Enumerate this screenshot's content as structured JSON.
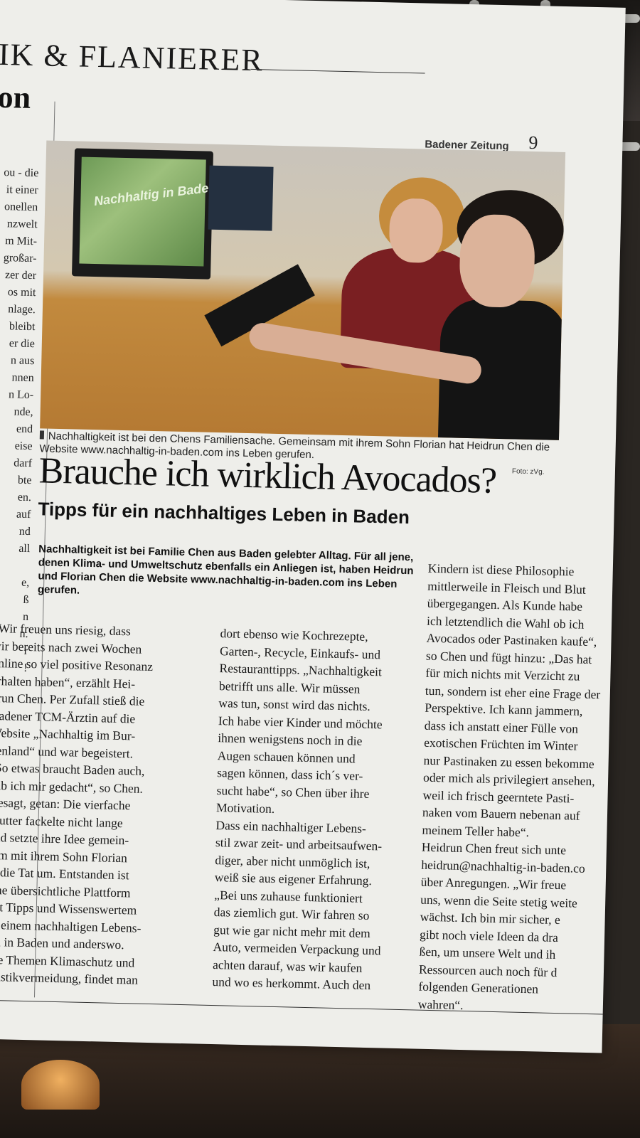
{
  "page": {
    "section_title": "IK & FLANIERER",
    "left_fragment": "on",
    "newspaper_name": "Badener Zeitung",
    "page_number": "9"
  },
  "left_column_fragment": "ou - die\nit einer\nonellen\nnzwelt\nm Mit-\ngroßar-\nzer der\nos mit\nnlage.\nbleibt\ner die\nn aus\nnnen\nn Lo-\nnde,\nend\neise\ndarf\nbte\nen.\nauf\nnd\nall\n\ne,\nß\nn\nn.\nr\n!",
  "photo": {
    "screen_text": "Nachhaltig in Baden",
    "caption": "Nachhaltigkeit ist bei den Chens Familiensache. Gemeinsam mit ihrem Sohn Florian hat Heidrun Chen die Website www.nachhaltig-in-baden.com ins Leben gerufen.",
    "credit": "Foto: zVg."
  },
  "article": {
    "headline": "Brauche ich wirklich Avocados?",
    "subheadline": "Tipps für ein nachhaltiges Leben in Baden",
    "lead": "Nachhaltigkeit ist bei Familie Chen aus Baden gelebter Alltag. Für all jene, denen Klima- und Umweltschutz ebenfalls ein Anliegen ist, haben Heidrun und Florian Chen die Website www.nachhaltig-in-baden.com ins Leben gerufen.",
    "column1": "„Wir freuen uns riesig, dass\nwir bereits nach zwei Wochen\nonline so viel positive Resonanz\nerhalten haben“, erzählt Hei-\ndrun Chen. Per Zufall stieß die\nBadener TCM-Ärztin auf die\nWebsite „Nachhaltig im Bur-\ngenland“ und war begeistert.\n„So etwas braucht Baden auch,\nhab ich mir gedacht“, so Chen.\n   Gesagt, getan: Die vierfache\nMutter fackelte nicht lange\nund setzte ihre Idee gemein-\nsam mit ihrem Sohn Florian\nin die Tat um. Entstanden ist\neine übersichtliche Plattform\nmit Tipps und Wissenswertem\nzu einem nachhaltigen Lebens-\nstil in Baden und anderswo.\nDie Themen Klimaschutz und\nPlastikvermeidung, findet man",
    "column2": "dort ebenso wie Kochrezepte,\nGarten-, Recycle, Einkaufs- und\nRestauranttipps. „Nachhaltigkeit\nbetrifft uns alle. Wir müssen\nwas tun, sonst wird das nichts.\nIch habe vier Kinder und möchte\nihnen wenigstens noch in die\nAugen schauen können und\nsagen können, dass ich´s ver-\nsucht habe“, so Chen über ihre\nMotivation.\n   Dass ein nachhaltiger Lebens-\nstil zwar zeit- und arbeitsaufwen-\ndiger, aber nicht unmöglich ist,\nweiß sie aus eigener Erfahrung.\n„Bei uns zuhause funktioniert\ndas ziemlich gut. Wir fahren so\ngut wie gar nicht mehr mit dem\nAuto, vermeiden Verpackung und\nachten darauf, was wir kaufen\nund wo es herkommt. Auch den",
    "column3": "Kindern ist diese Philosophie\nmittlerweile in Fleisch und Blut\nübergegangen. Als Kunde habe\nich letztendlich die Wahl ob ich\nAvocados oder Pastinaken kaufe“,\nso Chen und fügt hinzu: „Das hat\nfür mich nichts mit Verzicht zu\ntun, sondern ist eher eine Frage der\nPerspektive. Ich kann jammern,\ndass ich anstatt einer Fülle von\nexotischen Früchten im Winter\nnur Pastinaken zu essen bekomme\noder mich als privilegiert ansehen,\nweil ich frisch geerntete Pasti-\nnaken vom Bauern nebenan auf\nmeinem Teller habe“.\n   Heidrun Chen freut sich unte\nheidrun@nachhaltig-in-baden.co\nüber Anregungen. „Wir freue\nuns, wenn die Seite stetig weite\nwächst. Ich bin mir sicher, e\ngibt noch viele Ideen da dra\nßen, um unsere Welt und ih\nRessourcen auch noch für d\nfolgenden Generationen\nwahren“."
  }
}
